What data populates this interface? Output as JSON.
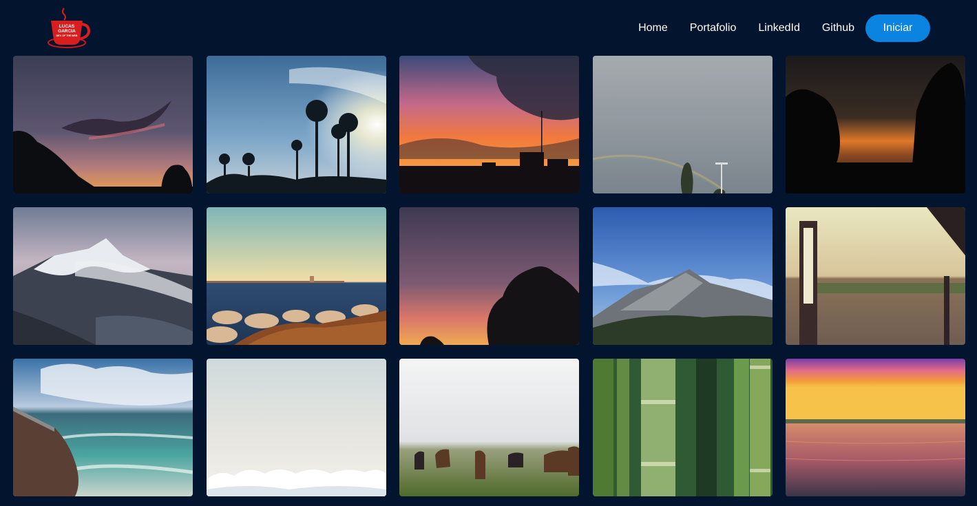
{
  "logo": {
    "line1": "LUCAS",
    "line2": "GARCIA",
    "line3": "DEV. OF THE WEB",
    "colors": {
      "cup": "#d81e1e",
      "saucer": "#c81818"
    }
  },
  "nav": {
    "items": [
      {
        "label": "Home"
      },
      {
        "label": "Portafolio"
      },
      {
        "label": "LinkedId"
      },
      {
        "label": "Github"
      }
    ],
    "cta_label": "Iniciar",
    "cta_color": "#0a84e0"
  },
  "gallery": {
    "photos": [
      {
        "subject": "dusk-sky-tree-silhouettes"
      },
      {
        "subject": "palm-trees-sunburst"
      },
      {
        "subject": "orange-sunset-city-skyline"
      },
      {
        "subject": "grey-sky-rainbow"
      },
      {
        "subject": "dark-sunset-tree-silhouettes"
      },
      {
        "subject": "snowy-mountain-clouds"
      },
      {
        "subject": "sea-horizon-rocks-pier"
      },
      {
        "subject": "purple-twilight-tree-silhouette"
      },
      {
        "subject": "rocky-mountain-blue-sky"
      },
      {
        "subject": "lamp-post-gravel-yard"
      },
      {
        "subject": "rocky-breakwater-waves"
      },
      {
        "subject": "pale-sky-above-clouds"
      },
      {
        "subject": "horses-in-meadow"
      },
      {
        "subject": "green-bamboo-stalks"
      },
      {
        "subject": "sunset-over-lake"
      }
    ]
  },
  "colors": {
    "background": "#03142e",
    "nav_text": "#ffffff"
  }
}
